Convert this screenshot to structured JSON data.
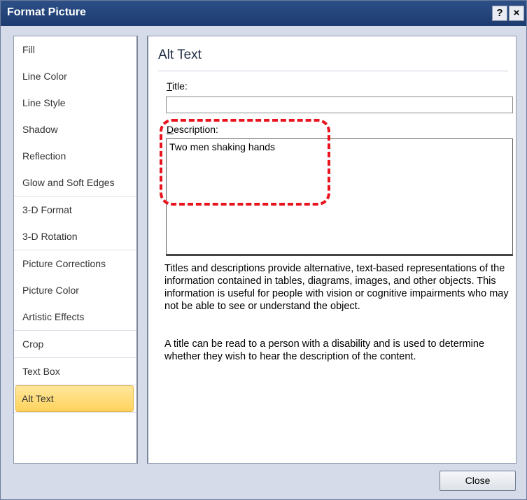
{
  "window": {
    "title": "Format Picture",
    "help_glyph": "?",
    "close_glyph": "×"
  },
  "sidebar": {
    "selected": "Alt Text",
    "groups": [
      [
        "Fill",
        "Line Color",
        "Line Style",
        "Shadow",
        "Reflection",
        "Glow and Soft Edges"
      ],
      [
        "3-D Format",
        "3-D Rotation"
      ],
      [
        "Picture Corrections",
        "Picture Color",
        "Artistic Effects"
      ],
      [
        "Crop"
      ],
      [
        "Text Box"
      ],
      [
        "Alt Text"
      ]
    ]
  },
  "content": {
    "heading": "Alt Text",
    "title_label_mnemonic": "T",
    "title_label_rest": "itle:",
    "title_value": "",
    "description_label_mnemonic": "D",
    "description_label_rest": "escription:",
    "description_value": "Two men shaking hands",
    "help_paragraph_1": "Titles and descriptions provide alternative, text-based representations of the information contained in tables, diagrams, images, and other objects. This information is useful for people with vision or cognitive impairments who may not be able to see or understand the object.",
    "help_paragraph_2": "A title can be read to a person with a disability and is used to determine whether they wish to hear the description of the content."
  },
  "footer": {
    "close_label": "Close"
  },
  "colors": {
    "titlebar": "#1d3c70",
    "selected_item": "#ffd25e",
    "highlight_annotation": "#e8141e"
  }
}
